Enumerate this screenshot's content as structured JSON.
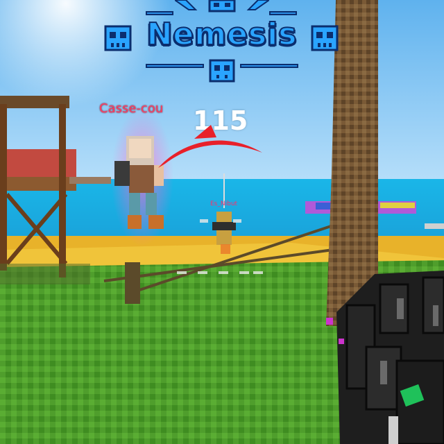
{
  "kill_banner": {
    "title": "Nemesis",
    "icon": "skull-icon",
    "color_fill": "#2aa4ff",
    "color_outline": "#0b2e6e"
  },
  "enemy_player": {
    "name": "Casse-cou",
    "name_color": "#ff3b5e",
    "aura_color": "#ff66cc"
  },
  "damage_indicator": {
    "value": "115",
    "arrow_color": "#e8202a"
  },
  "ally_player": {
    "name": "Es_Nibut"
  },
  "weapon": {
    "icon": "pixel-gun-icon",
    "accent_color": "#1fc15a"
  }
}
